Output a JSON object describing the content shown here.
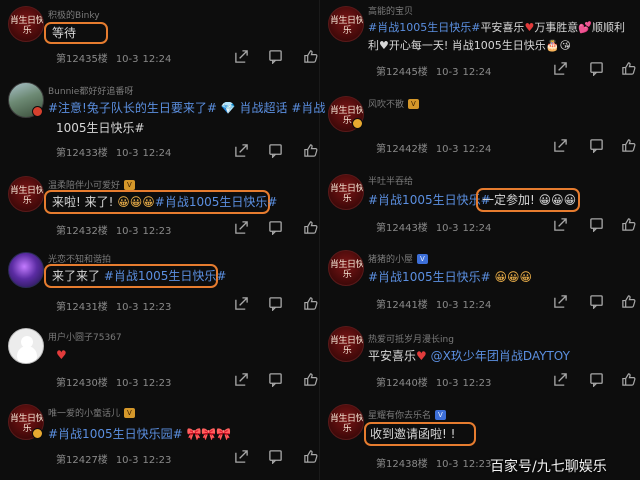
{
  "watermark": "百家号/九七聊娱乐",
  "left": [
    {
      "user": "积极的Binky",
      "level": "",
      "text_parts": [
        {
          "t": "等待",
          "c": "plain"
        }
      ],
      "floor": "第12435楼",
      "date": "10-3",
      "time": "12:24"
    },
    {
      "user": "Bunnie都好好追番呀",
      "level": "",
      "text_parts": [
        {
          "t": "#注意!兔子队长的生日要来了#",
          "c": "tag"
        },
        {
          "t": " 💎 ",
          "c": "emo"
        },
        {
          "t": "肖战超话 #肖战",
          "c": "tag"
        }
      ],
      "text_line2": "1005生日快乐#",
      "floor": "第12433楼",
      "date": "10-3",
      "time": "12:24"
    },
    {
      "user": "温柔陪伴小可爱好",
      "level": "V",
      "text_parts": [
        {
          "t": "来啦! 来了! ",
          "c": "plain"
        },
        {
          "t": "😀😀😀",
          "c": "emo"
        },
        {
          "t": "#肖战1005生日快乐#",
          "c": "tag"
        }
      ],
      "floor": "第12432楼",
      "date": "10-3",
      "time": "12:23"
    },
    {
      "user": "光恋不知和谐拍",
      "level": "",
      "text_parts": [
        {
          "t": "来了来了 ",
          "c": "plain"
        },
        {
          "t": "#肖战1005生日快乐#",
          "c": "tag"
        }
      ],
      "floor": "第12431楼",
      "date": "10-3",
      "time": "12:23"
    },
    {
      "user": "用户小圆子75367",
      "level": "",
      "text_parts": [
        {
          "t": "♥",
          "c": "heart"
        }
      ],
      "floor": "第12430楼",
      "date": "10-3",
      "time": "12:23"
    },
    {
      "user": "唯一爱的小童话儿",
      "level": "V",
      "text_parts": [
        {
          "t": "#肖战1005生日快乐园#",
          "c": "tag"
        },
        {
          "t": " 🎀🎀🎀",
          "c": "emo"
        }
      ],
      "floor": "第12427楼",
      "date": "10-3",
      "time": "12:23"
    }
  ],
  "right": [
    {
      "user": "高能的宝贝",
      "level": "",
      "text_parts": [
        {
          "t": "#肖战1005生日快乐#",
          "c": "tag"
        },
        {
          "t": "平安喜乐",
          "c": "plain"
        },
        {
          "t": "♥",
          "c": "heart"
        },
        {
          "t": "万事胜意",
          "c": "plain"
        },
        {
          "t": "💕",
          "c": "emo"
        },
        {
          "t": "顺顺利",
          "c": "plain"
        }
      ],
      "text_line2": "利♥开心每一天! 肖战1005生日快乐🎂😘",
      "floor": "第12445楼",
      "date": "10-3",
      "time": "12:24"
    },
    {
      "user": "风吹不散",
      "level": "V",
      "text_parts": [],
      "floor": "第12442楼",
      "date": "10-3",
      "time": "12:24"
    },
    {
      "user": "半吐半吞给",
      "level": "",
      "text_parts": [
        {
          "t": "#肖战1005生日快乐#",
          "c": "tag"
        }
      ],
      "boxed": "一定参加! 😀😀😀",
      "floor": "第12443楼",
      "date": "10-3",
      "time": "12:24"
    },
    {
      "user": "猪猪的小屋",
      "level": "V",
      "text_parts": [
        {
          "t": "#肖战1005生日快乐#",
          "c": "tag"
        },
        {
          "t": " 😀😀😀",
          "c": "emo"
        }
      ],
      "floor": "第12441楼",
      "date": "10-3",
      "time": "12:24"
    },
    {
      "user": "热爱可抵岁月漫长ing",
      "level": "",
      "text_parts": [
        {
          "t": "平安喜乐",
          "c": "plain"
        },
        {
          "t": "♥",
          "c": "heart"
        },
        {
          "t": " @X玖少年团肖战DAYTOY",
          "c": "tag"
        }
      ],
      "floor": "第12440楼",
      "date": "10-3",
      "time": "12:23"
    },
    {
      "user": "星耀有你去乐名",
      "level": "V",
      "text_parts": [
        {
          "t": "收到邀请函啦! !",
          "c": "plain"
        }
      ],
      "floor": "第12438楼",
      "date": "10-3",
      "time": "12:23"
    }
  ]
}
